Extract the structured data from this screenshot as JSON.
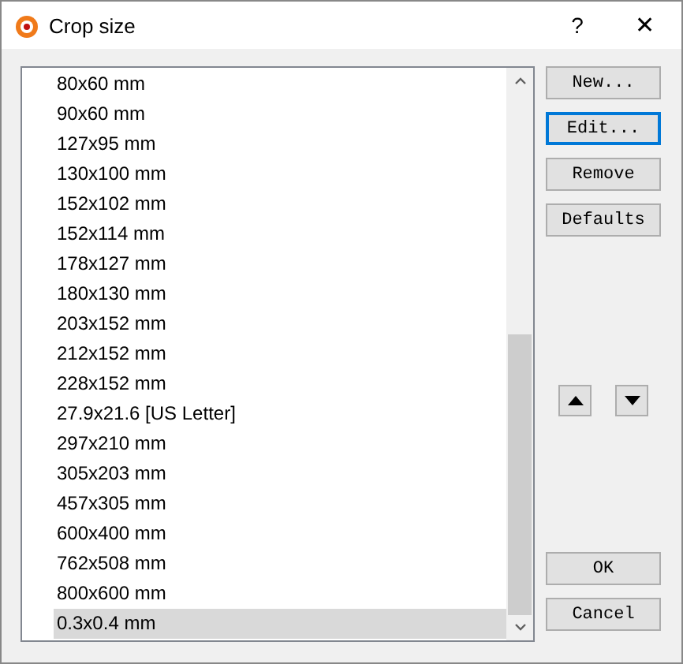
{
  "window": {
    "title": "Crop size",
    "help": "?",
    "close": "✕"
  },
  "sizes": [
    {
      "label": "80x60 mm",
      "selected": false
    },
    {
      "label": "90x60 mm",
      "selected": false
    },
    {
      "label": "127x95 mm",
      "selected": false
    },
    {
      "label": "130x100 mm",
      "selected": false
    },
    {
      "label": "152x102 mm",
      "selected": false
    },
    {
      "label": "152x114 mm",
      "selected": false
    },
    {
      "label": "178x127 mm",
      "selected": false
    },
    {
      "label": "180x130 mm",
      "selected": false
    },
    {
      "label": "203x152 mm",
      "selected": false
    },
    {
      "label": "212x152 mm",
      "selected": false
    },
    {
      "label": "228x152 mm",
      "selected": false
    },
    {
      "label": "27.9x21.6 [US Letter]",
      "selected": false
    },
    {
      "label": "297x210 mm",
      "selected": false
    },
    {
      "label": "305x203 mm",
      "selected": false
    },
    {
      "label": "457x305 mm",
      "selected": false
    },
    {
      "label": "600x400 mm",
      "selected": false
    },
    {
      "label": "762x508 mm",
      "selected": false
    },
    {
      "label": "800x600 mm",
      "selected": false
    },
    {
      "label": "0.3x0.4 mm",
      "selected": true
    }
  ],
  "actions": [
    {
      "label": "New...",
      "focused": false
    },
    {
      "label": "Edit...",
      "focused": true
    },
    {
      "label": "Remove",
      "focused": false
    },
    {
      "label": "Defaults",
      "focused": false
    }
  ],
  "dialog_buttons": [
    {
      "label": "OK",
      "focused": false
    },
    {
      "label": "Cancel",
      "focused": false
    }
  ]
}
